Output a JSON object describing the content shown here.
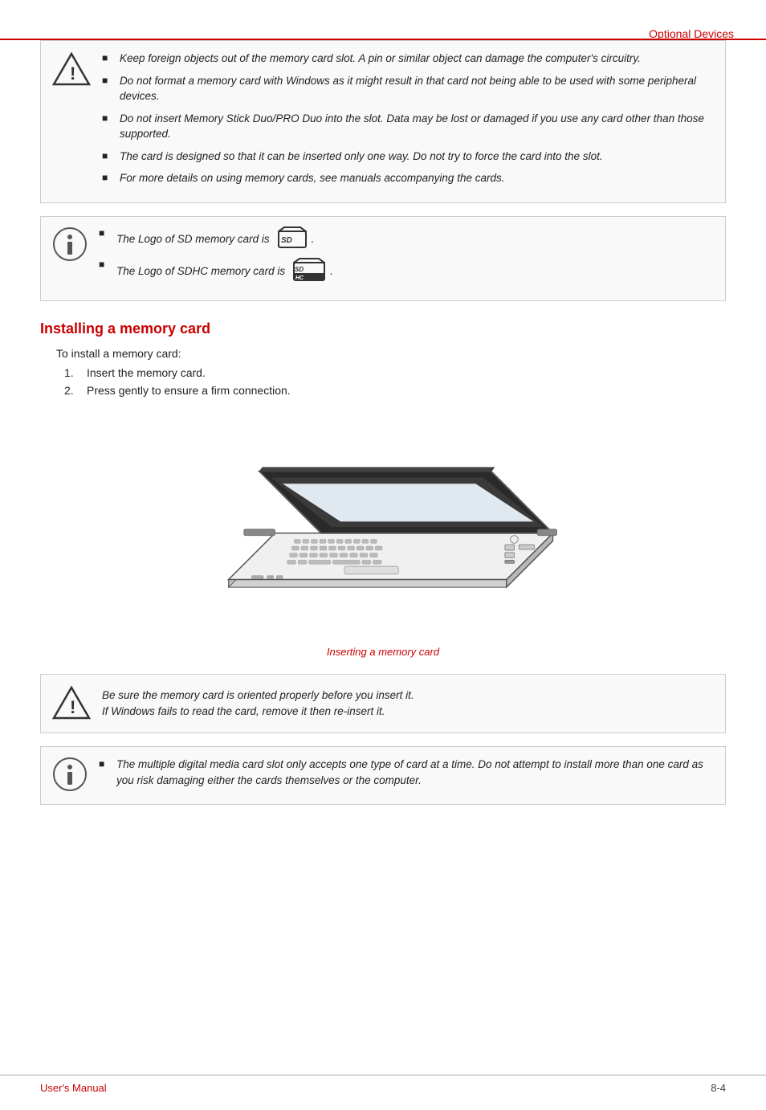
{
  "header": {
    "section_title": "Optional Devices",
    "top_line_color": "#c00"
  },
  "warning_box_1": {
    "items": [
      "Keep foreign objects out of the memory card slot. A pin or similar object can damage the computer's circuitry.",
      "Do not format a memory card with Windows as it might result in that card not being able to be used with some peripheral devices.",
      "Do not insert Memory Stick Duo/PRO Duo into the slot. Data may be lost or damaged if you use any card other than those supported.",
      "The card is designed so that it can be inserted only one way. Do not try to force the card into the slot.",
      "For more details on using memory cards, see manuals accompanying the cards."
    ]
  },
  "info_box_1": {
    "item1": "The Logo of SD memory card is",
    "item2": "The Logo of SDHC memory card is"
  },
  "installing_section": {
    "title": "Installing a memory card",
    "intro": "To install a memory card:",
    "steps": [
      {
        "num": "1.",
        "text": "Insert the memory card."
      },
      {
        "num": "2.",
        "text": "Press gently to ensure a firm connection."
      }
    ]
  },
  "illustration": {
    "caption": "Inserting a memory card"
  },
  "caution_box": {
    "line1": "Be sure the memory card is oriented properly before you insert it.",
    "line2": "If Windows fails to read the card, remove it then re-insert it."
  },
  "info_box_2": {
    "text": "The multiple digital media card slot only accepts one type of card at a time. Do not attempt to install more than one card as you risk damaging either the cards themselves or the computer."
  },
  "footer": {
    "left": "User's Manual",
    "right": "8-4"
  }
}
